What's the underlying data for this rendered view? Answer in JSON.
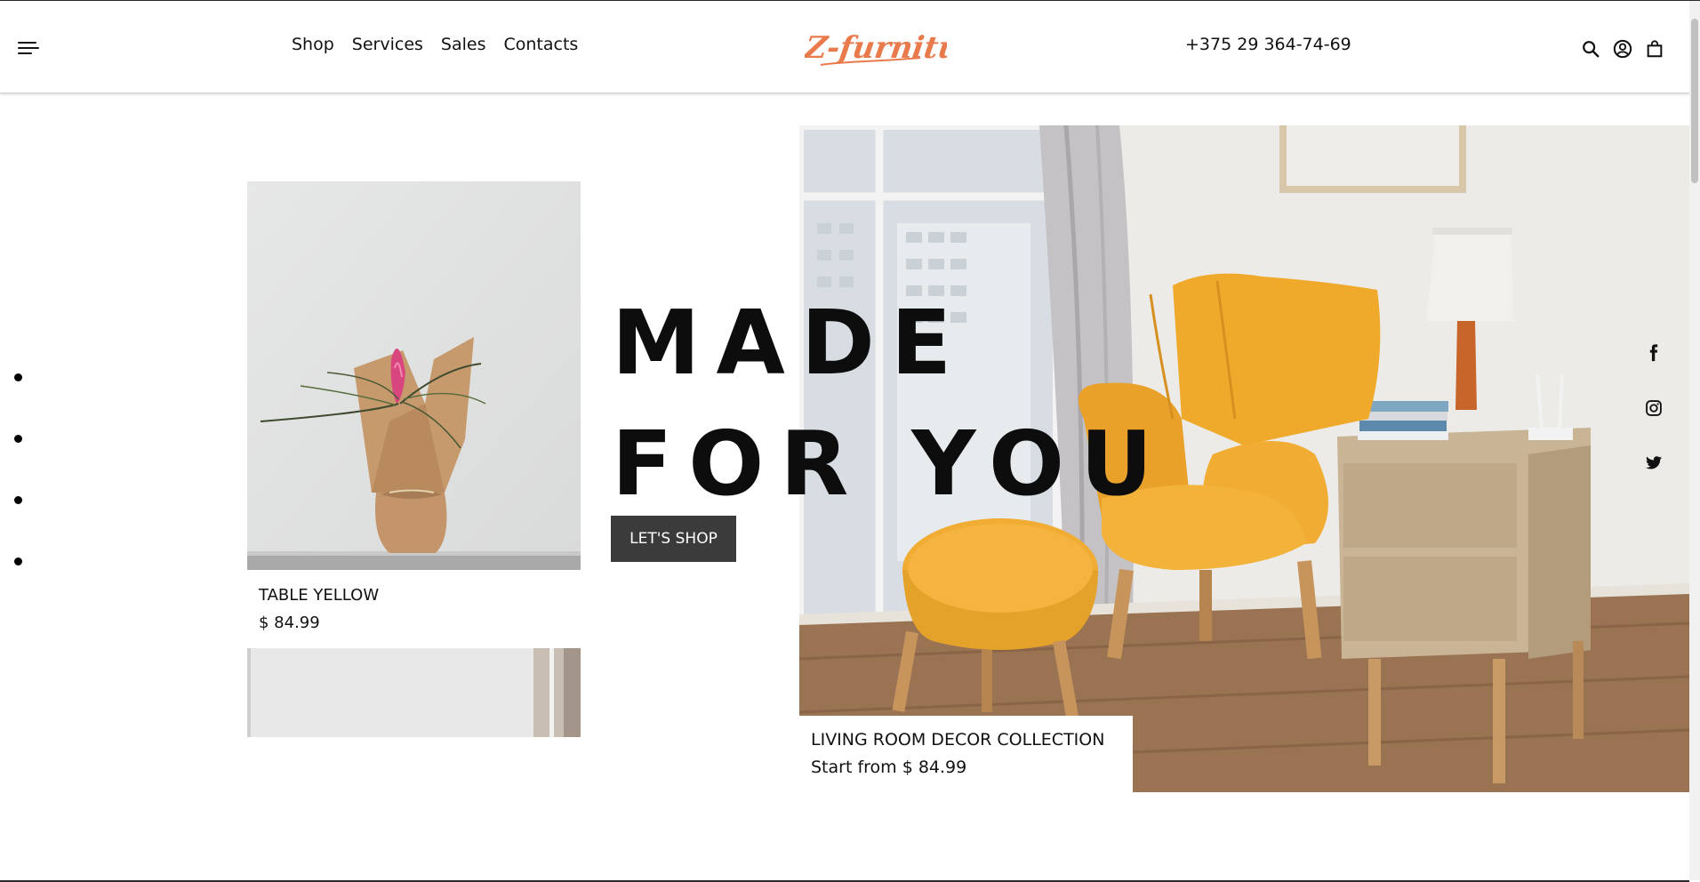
{
  "header": {
    "nav": [
      "Shop",
      "Services",
      "Sales",
      "Contacts"
    ],
    "logo_text": "Z-furniture",
    "phone": "+375 29 364-74-69",
    "icons": [
      "menu-icon",
      "search-icon",
      "user-icon",
      "bag-icon"
    ]
  },
  "hero": {
    "title_line1": "MADE",
    "title_line2": "FOR YOU",
    "button_label": "LET'S SHOP"
  },
  "products": [
    {
      "title": "TABLE YELLOW",
      "price": "$ 84.99"
    }
  ],
  "collection": {
    "title": "LIVING ROOM DECOR COLLECTION",
    "price": "Start from $ 84.99"
  },
  "social": [
    "facebook-icon",
    "instagram-icon",
    "twitter-icon"
  ],
  "colors": {
    "accent": "#e97a4c",
    "button": "#3b3b3b",
    "text": "#111111"
  }
}
